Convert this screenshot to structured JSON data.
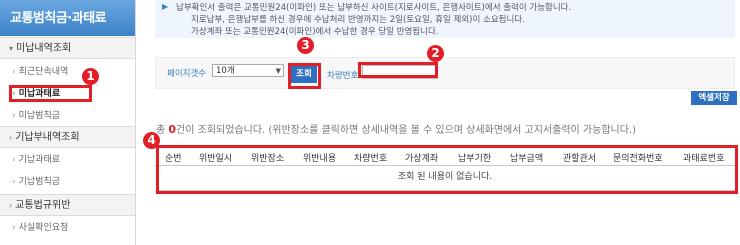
{
  "sidebar": {
    "title": "교통범칙금·과태료",
    "sections": [
      {
        "label": "미납내역조회",
        "items": [
          "최근단속내역",
          "미납과태료",
          "미납범칙금"
        ]
      },
      {
        "label": "기납부내역조회",
        "items": [
          "기납과태료",
          "기납범칙금"
        ]
      },
      {
        "label": "교통법규위반",
        "items": [
          "사실확인요청"
        ]
      }
    ]
  },
  "notice": {
    "lines": [
      "납부확인서 출력은 교통민원24(이파인) 또는 납부하신 사이트(지로사이트, 은행사이트)에서 출력이 가능합니다.",
      "지로납부, 은행납부를 하신 경우에 수납처리 반영까지는 2일(토요일, 휴일 제외)이 소요됩니다.",
      "가상계좌 또는 교통민원24(이파인)에서 수납한 경우 당일 반영됩니다."
    ]
  },
  "filter": {
    "pagecount_label": "페이지갯수",
    "pagecount_value": "10개",
    "search_label": "조회",
    "vehicle_label": "차량번호",
    "vehicle_value": ""
  },
  "excel_label": "엑셀저장",
  "result": {
    "prefix": "총 ",
    "count": "0",
    "suffix": "건이 조회되었습니다. (위반장소를 클릭하면 상세내역을 볼 수 있으며 상세화면에서 고지서출력이 가능합니다.)"
  },
  "table": {
    "columns": [
      "순번",
      "위반일시",
      "위반장소",
      "위반내용",
      "차량번호",
      "가상계좌",
      "납부기한",
      "납부금액",
      "관할관서",
      "문의전화번호",
      "과태료번호"
    ],
    "empty_message": "조회 된 내용이 없습니다."
  },
  "annotations": [
    "1",
    "2",
    "3",
    "4"
  ],
  "colors": {
    "accent": "#2e6fbf",
    "annotation": "#e21f26",
    "count": "#e02020"
  }
}
